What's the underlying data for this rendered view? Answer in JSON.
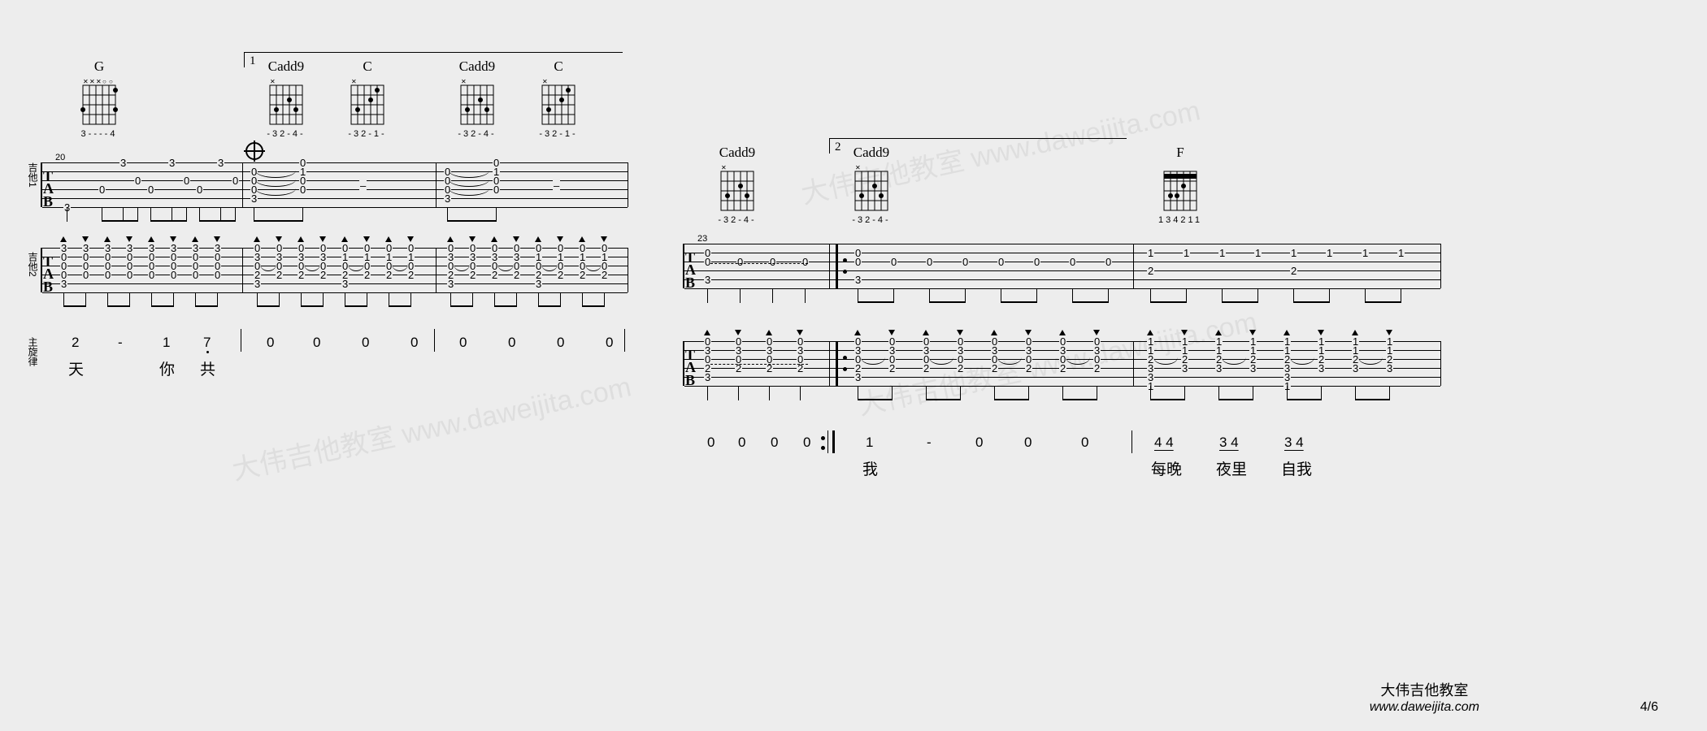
{
  "page": {
    "current": "4",
    "total": "6"
  },
  "footer": {
    "title": "大伟吉他教室",
    "site": "www.daweijita.com"
  },
  "watermark": "大伟吉他教室 www.daweijita.com",
  "tracks": {
    "g1": "吉他1",
    "g2": "吉他2",
    "mel": "主旋律"
  },
  "chords": {
    "G": {
      "name": "G",
      "fingering": "3----4",
      "dots": [
        [
          5,
          2
        ],
        [
          0,
          3
        ],
        [
          5,
          3
        ]
      ],
      "muted": [
        1,
        2,
        3
      ],
      "open": [
        4
      ]
    },
    "Cadd9": {
      "name": "Cadd9",
      "fingering": "-32-4-",
      "dots": [
        [
          1,
          3
        ],
        [
          3,
          2
        ],
        [
          4,
          3
        ]
      ],
      "muted": [
        0
      ],
      "open": [
        2,
        5
      ]
    },
    "C": {
      "name": "C",
      "fingering": "-32-1-",
      "dots": [
        [
          1,
          3
        ],
        [
          3,
          2
        ],
        [
          4,
          1
        ]
      ],
      "muted": [
        0
      ],
      "open": [
        2,
        5
      ]
    },
    "F": {
      "name": "F",
      "fingering": "134211",
      "barre": {
        "fret": 1,
        "from": 0,
        "to": 5
      },
      "dots": [
        [
          1,
          3
        ],
        [
          2,
          3
        ],
        [
          3,
          2
        ]
      ],
      "muted": [],
      "open": []
    }
  },
  "left": {
    "measureStart": "20",
    "volta1": "1",
    "g1": {
      "m1": [
        [
          "3"
        ],
        [
          "0",
          "3",
          "0"
        ],
        [
          "0",
          "3",
          "0"
        ],
        [
          "0",
          "3",
          "0"
        ]
      ],
      "m2": [
        [
          "3"
        ],
        [
          "0",
          "0",
          "0"
        ],
        [
          "1",
          "0",
          "0"
        ],
        [
          "",
          "",
          "-"
        ]
      ],
      "m3": [
        [
          "3"
        ],
        [
          "0",
          "0",
          "0"
        ],
        [
          "1",
          "0",
          "0"
        ],
        [
          "",
          "",
          "-"
        ]
      ]
    },
    "g2": {
      "m1": [
        [
          "3",
          "0",
          "0",
          "0",
          "3"
        ],
        [
          "3",
          "0",
          "0",
          "0"
        ],
        [
          "3",
          "0",
          "0",
          "0"
        ],
        [
          "3",
          "0",
          "0",
          "0"
        ],
        [
          "3",
          "0",
          "0",
          "0"
        ],
        [
          "3",
          "0",
          "0",
          "0"
        ],
        [
          "3",
          "0",
          "0",
          "0"
        ],
        [
          "3",
          "0",
          "0",
          "0"
        ]
      ],
      "m2": [
        [
          "0",
          "3",
          "0",
          "2",
          "3"
        ],
        [
          "0",
          "3",
          "0",
          "2"
        ],
        [
          "0",
          "3",
          "0",
          "2"
        ],
        [
          "0",
          "3",
          "0",
          "2"
        ],
        [
          "0",
          "1",
          "0",
          "2",
          "3"
        ],
        [
          "0",
          "1",
          "0",
          "2"
        ],
        [
          "0",
          "1",
          "0",
          "2"
        ],
        [
          "0",
          "1",
          "0",
          "2"
        ]
      ],
      "m3": [
        [
          "0",
          "3",
          "0",
          "2",
          "3"
        ],
        [
          "0",
          "3",
          "0",
          "2"
        ],
        [
          "0",
          "3",
          "0",
          "2"
        ],
        [
          "0",
          "3",
          "0",
          "2"
        ],
        [
          "0",
          "1",
          "0",
          "2",
          "3"
        ],
        [
          "0",
          "1",
          "0",
          "2"
        ],
        [
          "0",
          "1",
          "0",
          "2"
        ],
        [
          "0",
          "1",
          "0",
          "2"
        ]
      ]
    },
    "mel": {
      "nums": [
        "2",
        "-",
        "1",
        "7",
        "0",
        "0",
        "0",
        "0",
        "0",
        "0",
        "0",
        "0"
      ],
      "lyr": [
        "天",
        "",
        "你",
        "共"
      ]
    }
  },
  "right": {
    "measureStart": "23",
    "volta2": "2",
    "g1": {
      "m1": [
        [
          "3",
          "0",
          "0"
        ],
        [
          "0"
        ],
        [
          "0"
        ],
        [
          "0"
        ]
      ],
      "m2": [
        [
          "3",
          "0",
          "0"
        ],
        [
          "0"
        ],
        [
          "0"
        ],
        [
          "0"
        ],
        [
          "0"
        ],
        [
          "0"
        ],
        [
          "0"
        ],
        [
          "0"
        ]
      ],
      "m3": [
        [
          "1",
          "2"
        ],
        [
          "1"
        ],
        [
          "1"
        ],
        [
          "1"
        ],
        [
          "1",
          "2"
        ],
        [
          "1"
        ],
        [
          "1"
        ],
        [
          "1"
        ]
      ]
    },
    "g2": {
      "m1": [
        [
          "0",
          "3",
          "0",
          "2",
          "3"
        ],
        [
          "0",
          "3",
          "0",
          "2"
        ],
        [
          "0",
          "3",
          "0",
          "2"
        ],
        [
          "0",
          "3",
          "0",
          "2"
        ]
      ],
      "m2": [
        [
          "0",
          "3",
          "0",
          "2",
          "3"
        ],
        [
          "0",
          "3",
          "0",
          "2"
        ],
        [
          "0",
          "3",
          "0",
          "2"
        ],
        [
          "0",
          "3",
          "0",
          "2"
        ],
        [
          "0",
          "3",
          "0",
          "2"
        ],
        [
          "0",
          "3",
          "0",
          "2"
        ],
        [
          "0",
          "3",
          "0",
          "2"
        ],
        [
          "0",
          "3",
          "0",
          "2"
        ]
      ],
      "m3": [
        [
          "1",
          "1",
          "2",
          "3",
          "3",
          "1"
        ],
        [
          "1",
          "1",
          "2",
          "3"
        ],
        [
          "1",
          "1",
          "2",
          "3"
        ],
        [
          "1",
          "1",
          "2",
          "3"
        ],
        [
          "1",
          "1",
          "2",
          "3",
          "3",
          "1"
        ],
        [
          "1",
          "1",
          "2",
          "3"
        ],
        [
          "1",
          "1",
          "2",
          "3"
        ],
        [
          "1",
          "1",
          "2",
          "3"
        ]
      ]
    },
    "mel": {
      "nums": [
        "0",
        "0",
        "0",
        "0",
        "1",
        "-",
        "0",
        "0",
        "0",
        "4 4",
        "3 4",
        "3 4"
      ],
      "lyr": [
        "",
        "",
        "",
        "",
        "我",
        "",
        "",
        "",
        "",
        "每晚",
        "夜里",
        "自我"
      ]
    }
  }
}
